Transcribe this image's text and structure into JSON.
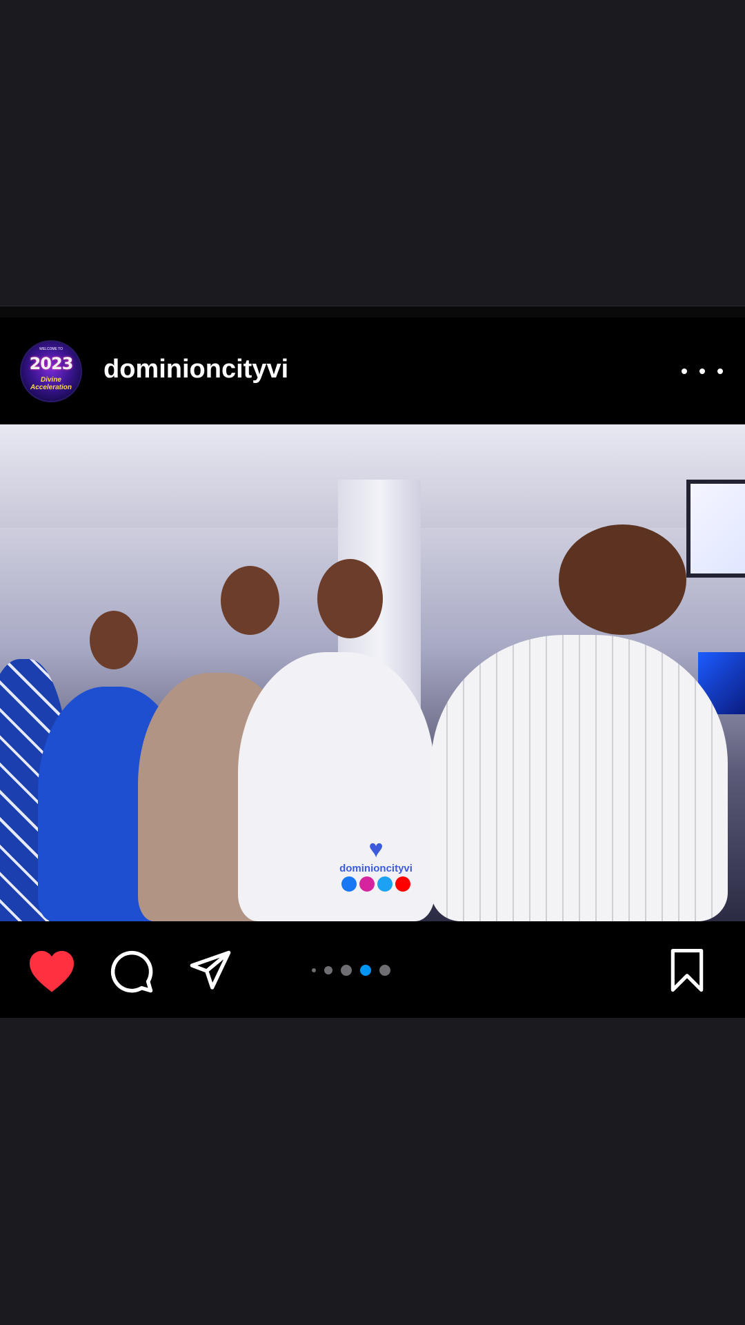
{
  "post": {
    "username": "dominioncityvi",
    "avatar": {
      "welcome_text": "WELCOME TO",
      "year_text": "2023",
      "tagline": "Divine Acceleration"
    },
    "more_icon": "more-horizontal-icon"
  },
  "photo": {
    "watermark_text": "dominioncityvi",
    "watermark_icons": [
      "facebook-icon",
      "instagram-icon",
      "twitter-icon",
      "youtube-icon"
    ]
  },
  "actions": {
    "like_icon": "heart-filled-icon",
    "comment_icon": "comment-icon",
    "share_icon": "send-icon",
    "save_icon": "bookmark-icon",
    "like_color": "#ff3040",
    "active_dot_color": "#0095f6"
  },
  "carousel": {
    "total_dots_visible": 5,
    "active_index": 3
  }
}
